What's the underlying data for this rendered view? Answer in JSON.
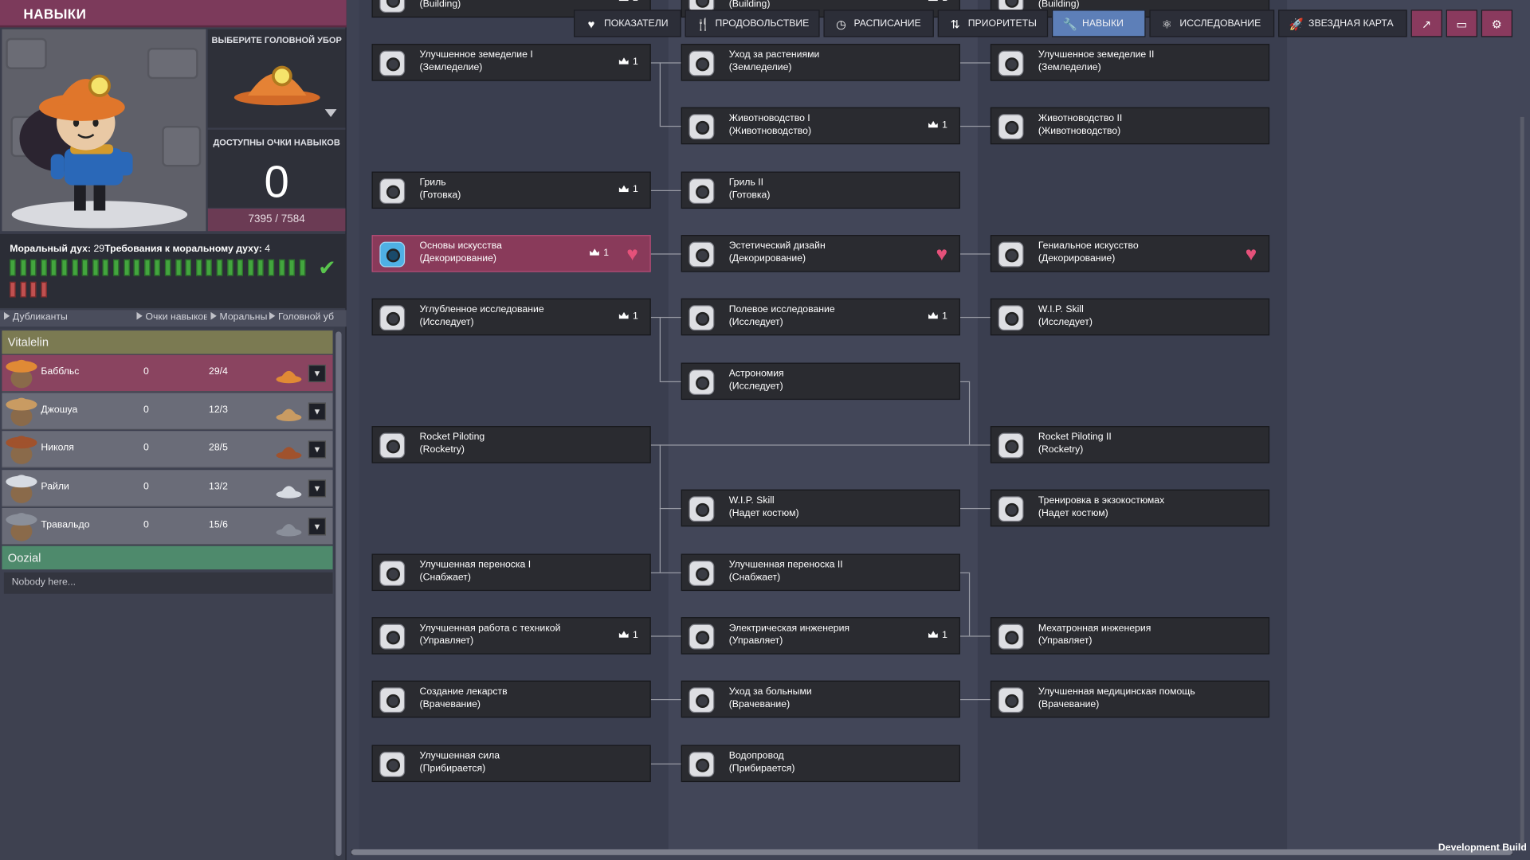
{
  "panel": {
    "title": "НАВЫКИ",
    "hat_label": "ВЫБЕРИТЕ ГОЛОВНОЙ УБОР",
    "points_label": "ДОСТУПНЫ ОЧКИ НАВЫКОВ",
    "points_value": "0",
    "xp": "7395 / 7584",
    "xp_fraction": 0.9757,
    "morale_label": "Моральный дух: ",
    "morale_value": "29",
    "morale_req_label": "Требования к моральному духу: ",
    "morale_req_value": "4",
    "morale_green_bars": 29,
    "morale_red_bars": 4
  },
  "columns": {
    "dupes": "Дубликанты",
    "points": "Очки навыков",
    "morale": "Моральный дух",
    "hat": "Головной убор"
  },
  "groups": [
    {
      "name": "Vitalelin",
      "color": "#7b7a52"
    },
    {
      "name": "Oozial",
      "color": "#4e8a6c"
    }
  ],
  "dupes": [
    {
      "name": "Баббльс",
      "points": "0",
      "morale": "29/4"
    },
    {
      "name": "Джошуа",
      "points": "0",
      "morale": "12/3"
    },
    {
      "name": "Николя",
      "points": "0",
      "morale": "28/5"
    },
    {
      "name": "Райли",
      "points": "0",
      "morale": "13/2"
    },
    {
      "name": "Травальдо",
      "points": "0",
      "morale": "15/6"
    }
  ],
  "nobody": "Nobody here...",
  "tabs": [
    {
      "label": "ПОКАЗАТЕЛИ",
      "icon": "heart-icon"
    },
    {
      "label": "ПРОДОВОЛЬСТВИЕ",
      "icon": "food-icon"
    },
    {
      "label": "РАСПИСАНИЕ",
      "icon": "clock-icon"
    },
    {
      "label": "ПРИОРИТЕТЫ",
      "icon": "priority-icon"
    },
    {
      "label": "НАВЫКИ",
      "icon": "wrench-icon"
    },
    {
      "label": "ИССЛЕДОВАНИЕ",
      "icon": "atom-icon"
    },
    {
      "label": "ЗВЕЗДНАЯ КАРТА",
      "icon": "rocket-icon"
    }
  ],
  "tab_icons": [
    "chart-icon",
    "book-icon",
    "gear-icon"
  ],
  "skills": {
    "top0": {
      "name": "",
      "sub": "(Building)",
      "count": "2"
    },
    "top1": {
      "name": "",
      "sub": "(Building)",
      "count": "1"
    },
    "top2": {
      "name": "",
      "sub": "(Building)",
      "count": ""
    },
    "r0c0": {
      "name": "Улучшенное земеделие I",
      "sub": "(Земледелие)",
      "count": "1"
    },
    "r0c1": {
      "name": "Уход за растениями",
      "sub": "(Земледелие)",
      "count": ""
    },
    "r0c2": {
      "name": "Улучшенное земеделие II",
      "sub": "(Земледелие)",
      "count": ""
    },
    "r1c1": {
      "name": "Животноводство I",
      "sub": "(Животноводство)",
      "count": "1"
    },
    "r1c2": {
      "name": "Животноводство II",
      "sub": "(Животноводство)",
      "count": ""
    },
    "r2c0": {
      "name": "Гриль",
      "sub": "(Готовка)",
      "count": "1"
    },
    "r2c1": {
      "name": "Гриль II",
      "sub": "(Готовка)",
      "count": ""
    },
    "r3c0": {
      "name": "Основы искусства",
      "sub": "(Декорирование)",
      "count": "1"
    },
    "r3c1": {
      "name": "Эстетический дизайн",
      "sub": "(Декорирование)",
      "count": ""
    },
    "r3c2": {
      "name": "Гениальное искусство",
      "sub": "(Декорирование)",
      "count": ""
    },
    "r4c0": {
      "name": "Углубленное исследование",
      "sub": "(Исследует)",
      "count": "1"
    },
    "r4c1": {
      "name": "Полевое исследование",
      "sub": "(Исследует)",
      "count": "1"
    },
    "r4c2": {
      "name": "W.I.P. Skill",
      "sub": "(Исследует)",
      "count": ""
    },
    "r5c1": {
      "name": "Астрономия",
      "sub": "(Исследует)",
      "count": ""
    },
    "r6c0": {
      "name": "Rocket Piloting",
      "sub": "(Rocketry)",
      "count": ""
    },
    "r6c2": {
      "name": "Rocket Piloting II",
      "sub": "(Rocketry)",
      "count": ""
    },
    "r7c1": {
      "name": "W.I.P. Skill",
      "sub": "(Надет костюм)",
      "count": ""
    },
    "r7c2": {
      "name": "Тренировка в экзокостюмах",
      "sub": "(Надет костюм)",
      "count": ""
    },
    "r8c0": {
      "name": "Улучшенная переноска I",
      "sub": "(Снабжает)",
      "count": ""
    },
    "r8c1": {
      "name": "Улучшенная переноска II",
      "sub": "(Снабжает)",
      "count": ""
    },
    "r9c0": {
      "name": "Улучшенная работа с техникой",
      "sub": "(Управляет)",
      "count": "1"
    },
    "r9c1": {
      "name": "Электрическая инженерия",
      "sub": "(Управляет)",
      "count": "1"
    },
    "r9c2": {
      "name": "Мехатронная инженерия",
      "sub": "(Управляет)",
      "count": ""
    },
    "r10c0": {
      "name": "Создание лекарств",
      "sub": "(Врачевание)",
      "count": ""
    },
    "r10c1": {
      "name": "Уход за больными",
      "sub": "(Врачевание)",
      "count": ""
    },
    "r10c2": {
      "name": "Улучшенная медицинская помощь",
      "sub": "(Врачевание)",
      "count": ""
    },
    "r11c0": {
      "name": "Улучшенная сила",
      "sub": "(Прибирается)",
      "count": ""
    },
    "r11c1": {
      "name": "Водопровод",
      "sub": "(Прибирается)",
      "count": ""
    }
  },
  "footer": "Development Build",
  "colors": {
    "accent_pink": "#893a5a",
    "tab_active": "#5d7fb8",
    "morale_green": "#43a53e",
    "morale_red": "#c05050",
    "heart": "#e5517a"
  }
}
